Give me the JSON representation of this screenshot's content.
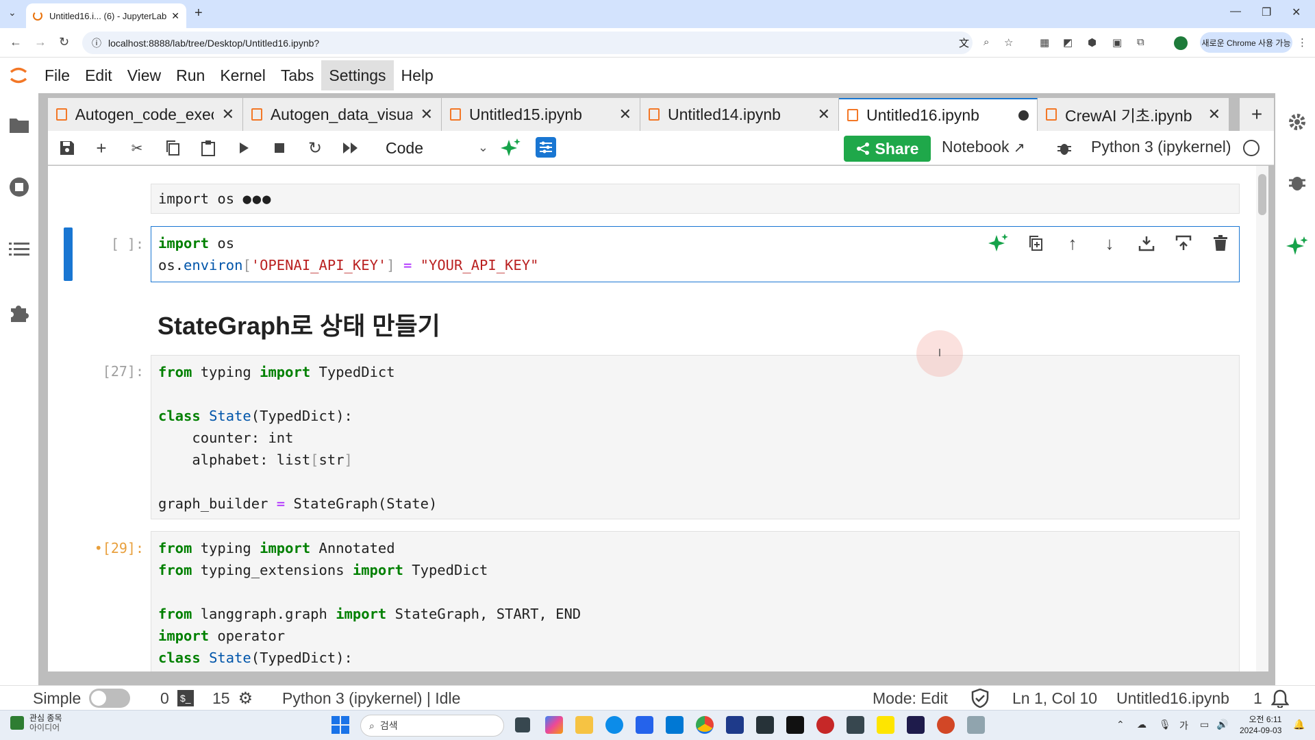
{
  "browser": {
    "tab_title": "Untitled16.i... (6) - JupyterLab",
    "url": "localhost:8888/lab/tree/Desktop/Untitled16.ipynb?",
    "promo": "새로운 Chrome 사용 가능"
  },
  "menu": [
    "File",
    "Edit",
    "View",
    "Run",
    "Kernel",
    "Tabs",
    "Settings",
    "Help"
  ],
  "doc_tabs": [
    {
      "label": "Autogen_code_exec",
      "status": "close"
    },
    {
      "label": "Autogen_data_visua",
      "status": "close"
    },
    {
      "label": "Untitled15.ipynb",
      "status": "close"
    },
    {
      "label": "Untitled14.ipynb",
      "status": "close"
    },
    {
      "label": "Untitled16.ipynb",
      "status": "unsaved"
    },
    {
      "label": "CrewAI 기초.ipynb",
      "status": "close"
    }
  ],
  "toolbar": {
    "cell_type": "Code",
    "share_label": "Share",
    "notebook_label": "Notebook",
    "kernel": "Python 3 (ipykernel)"
  },
  "cells": {
    "collapsed_preview": "import os",
    "active_prompt": "[ ]:",
    "markdown_heading": "StateGraph로 상태 만들기",
    "cell27_prompt": "[27]:",
    "cell29_prompt": "•[29]:"
  },
  "status": {
    "mode_simple": "Simple",
    "terminals": "0",
    "kernels": "15",
    "kernel_status": "Python 3 (ipykernel) | Idle",
    "mode": "Mode: Edit",
    "position": "Ln 1, Col 10",
    "filename": "Untitled16.ipynb",
    "notifications": "1"
  },
  "taskbar": {
    "widget_line1": "관심 종목",
    "widget_line2": "아이디어",
    "search_placeholder": "검색",
    "time": "오전 6:11",
    "date": "2024-09-03",
    "ime": "가"
  },
  "colors": {
    "jupyter_orange": "#f37726",
    "active_blue": "#1976d2",
    "share_green": "#1fa84a",
    "keyword_green": "#008000",
    "string_red": "#ba2121"
  }
}
